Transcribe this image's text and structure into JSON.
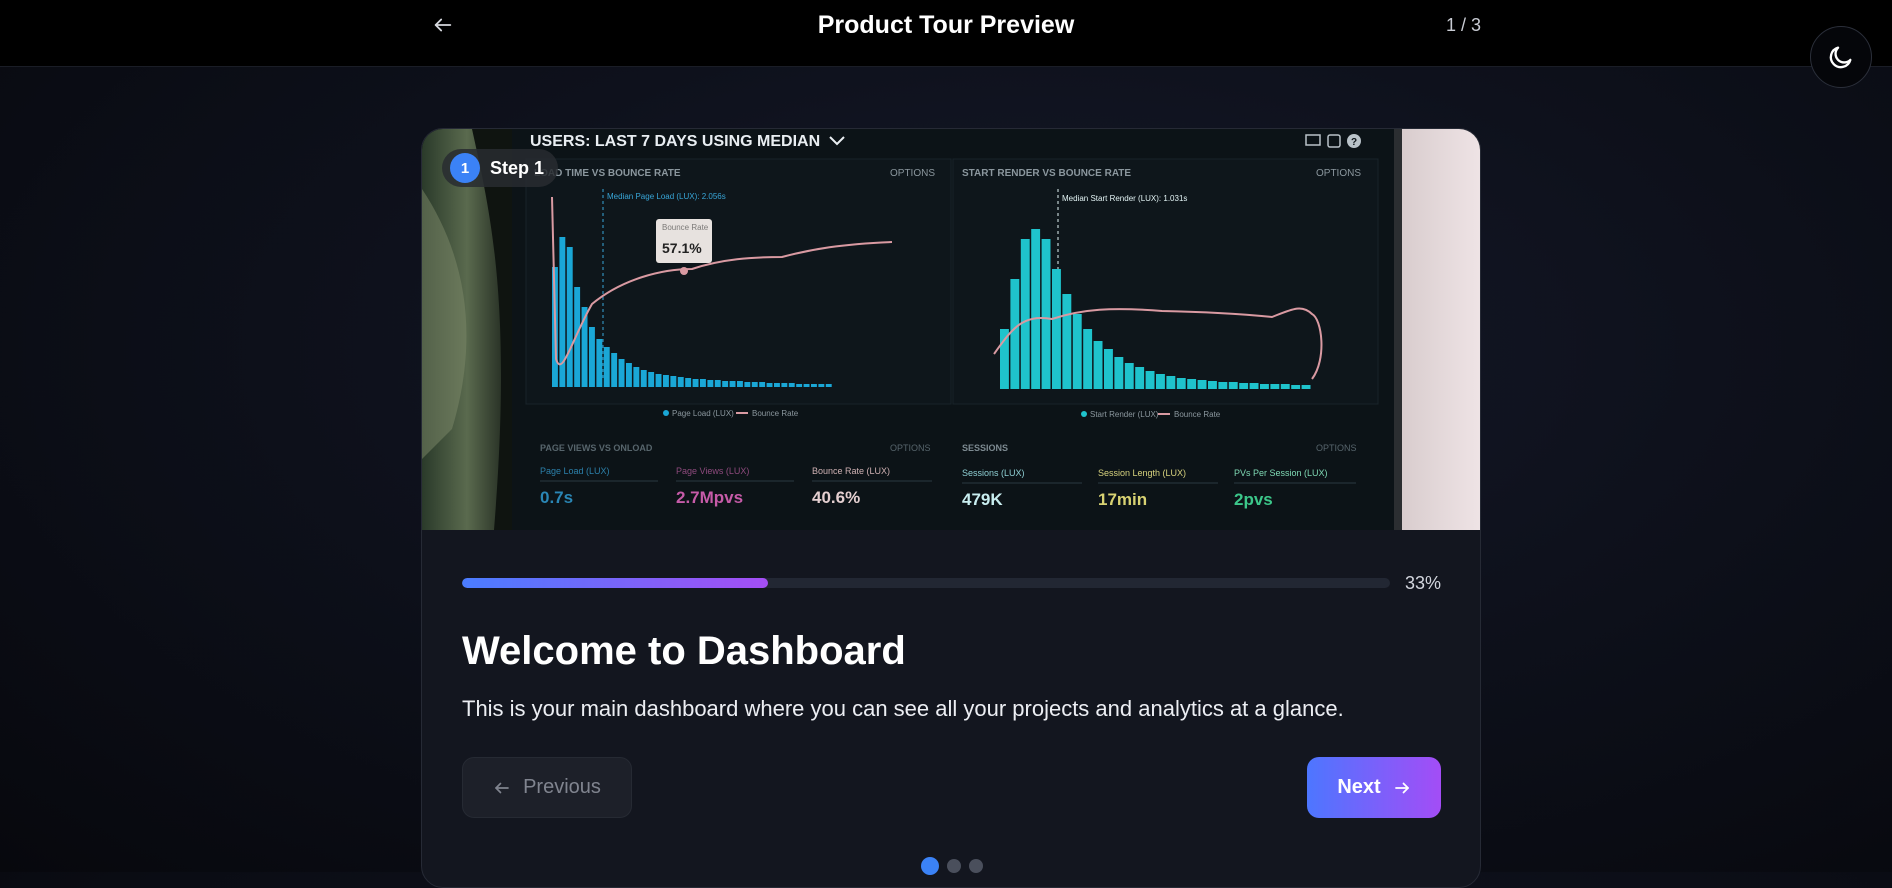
{
  "header": {
    "title": "Product Tour Preview",
    "counter": "1 / 3",
    "back_icon": "arrow-left-icon",
    "theme_icon": "moon-icon"
  },
  "step": {
    "badge_number": "1",
    "badge_label": "Step 1",
    "title": "Welcome to Dashboard",
    "description": "This is your main dashboard where you can see all your projects and analytics at a glance.",
    "progress_percent": 33,
    "progress_label": "33%"
  },
  "nav": {
    "previous_label": "Previous",
    "next_label": "Next",
    "total_steps": 3,
    "current_step": 1
  },
  "hero_image": {
    "heading": "USERS: LAST 7 DAYS USING MEDIAN",
    "panels": [
      {
        "title": "LOAD TIME VS BOUNCE RATE",
        "options": "OPTIONS",
        "annotation": "Median Page Load (LUX): 2.056s",
        "tooltip_label": "Bounce Rate",
        "tooltip_value": "57.1%",
        "legend": [
          "Page Load (LUX)",
          "Bounce Rate"
        ]
      },
      {
        "title": "START RENDER VS BOUNCE RATE",
        "options": "OPTIONS",
        "annotation": "Median Start Render (LUX): 1.031s",
        "legend": [
          "Start Render (LUX)",
          "Bounce Rate"
        ]
      }
    ],
    "sections": [
      {
        "title": "PAGE VIEWS VS ONLOAD",
        "options": "OPTIONS",
        "metrics": [
          {
            "label": "Page Load (LUX)",
            "value": "0.7s"
          },
          {
            "label": "Page Views (LUX)",
            "value": "2.7Mpvs"
          },
          {
            "label": "Bounce Rate (LUX)",
            "value": "40.6%"
          }
        ]
      },
      {
        "title": "SESSIONS",
        "options": "OPTIONS",
        "metrics": [
          {
            "label": "Sessions (LUX)",
            "value": "479K"
          },
          {
            "label": "Session Length (LUX)",
            "value": "17min"
          },
          {
            "label": "PVs Per Session (LUX)",
            "value": "2pvs"
          }
        ]
      }
    ],
    "colors": {
      "bar_left": "#1aa7d6",
      "bar_right": "#1fc3cc",
      "bounce_line": "#d99aa2",
      "pink_value": "#c65ba8",
      "green_value": "#3cc78a"
    }
  },
  "colors": {
    "accent_blue": "#3b82f6",
    "accent_purple": "#a54ef5",
    "card_bg": "#13161f"
  }
}
